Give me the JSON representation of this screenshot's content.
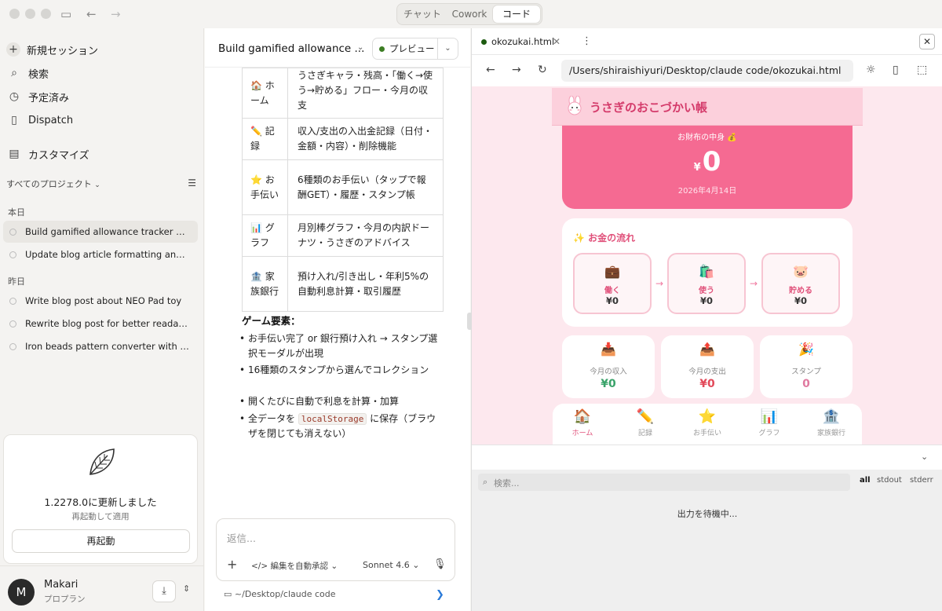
{
  "modes": {
    "items": [
      "チャット",
      "Cowork",
      "コード"
    ],
    "active": 2
  },
  "sidebar": {
    "nav": [
      {
        "label": "新規セッション",
        "icon": "plus-icon"
      },
      {
        "label": "検索",
        "icon": "search-icon"
      },
      {
        "label": "予定済み",
        "icon": "clock-icon"
      },
      {
        "label": "Dispatch",
        "icon": "phone-icon"
      },
      {
        "label": "カスタマイズ",
        "icon": "briefcase-icon"
      }
    ],
    "projects_label": "すべてのプロジェクト",
    "today_label": "本日",
    "yesterday_label": "昨日",
    "today_sessions": [
      "Build gamified allowance tracker app f...",
      "Update blog article formatting and rela..."
    ],
    "yesterday_sessions": [
      "Write blog post about NEO Pad toy",
      "Rewrite blog post for better readability",
      "Iron beads pattern converter with PDF ..."
    ],
    "update": {
      "title": "1.2278.0に更新しました",
      "subtitle": "再起動して適用",
      "button": "再起動"
    },
    "user": {
      "initial": "M",
      "name": "Makari",
      "plan": "プロプラン"
    }
  },
  "chat": {
    "title": "Build gamified allowance ...",
    "preview_label": "プレビュー",
    "table": [
      {
        "key": "🏠 ホーム",
        "value": "うさぎキャラ・残高・「働く→使う→貯める」フロー・今月の収支"
      },
      {
        "key": "✏️ 記録",
        "value": "収入/支出の入出金記録（日付・金額・内容）・削除機能"
      },
      {
        "key": "⭐ お手伝い",
        "value": "6種類のお手伝い（タップで報酬GET）・履歴・スタンプ帳"
      },
      {
        "key": "📊 グラフ",
        "value": "月別棒グラフ・今月の内訳ドーナツ・うさぎのアドバイス"
      },
      {
        "key": "🏦 家族銀行",
        "value": "預け入れ/引き出し・年利5%の自動利息計算・取引履歴"
      }
    ],
    "game_heading": "ゲーム要素：",
    "bullets": [
      "お手伝い完了 or 銀行預け入れ → スタンプ選択モーダルが出現",
      "16種類のスタンプから選んでコレクション",
      "開くたびに自動で利息を計算・加算"
    ],
    "bullet4_pre": "全データを",
    "bullet4_code": "localStorage",
    "bullet4_post": "に保存（ブラウザを閉じても消えない）",
    "composer": {
      "placeholder": "返信...",
      "mode": "</> 編集を自動承認",
      "model": "Sonnet 4.6"
    },
    "footer_path": "~/Desktop/claude code"
  },
  "preview": {
    "tab_title": "okozukai.html",
    "url": "/Users/shiraishiyuri/Desktop/claude code/okozukai.html",
    "app_title": "うさぎのおこづかい帳",
    "wallet_label": "お財布の中身 💰",
    "currency": "¥",
    "balance": "0",
    "date": "2026年4月14日",
    "flow_title": "✨ お金の流れ",
    "flow": [
      {
        "emoji": "💼",
        "label": "働く",
        "amount": "¥0"
      },
      {
        "emoji": "🛍️",
        "label": "使う",
        "amount": "¥0"
      },
      {
        "emoji": "🐷",
        "label": "貯める",
        "amount": "¥0"
      }
    ],
    "stats": [
      {
        "emoji": "📥",
        "label": "今月の収入",
        "value": "¥0",
        "color": "#3aa36a"
      },
      {
        "emoji": "📤",
        "label": "今月の支出",
        "value": "¥0",
        "color": "#e24a5a"
      },
      {
        "emoji": "🎉",
        "label": "スタンプ",
        "value": "0",
        "color": "#e07aa0"
      }
    ],
    "nav": [
      {
        "emoji": "🏠",
        "label": "ホーム"
      },
      {
        "emoji": "✏️",
        "label": "記録"
      },
      {
        "emoji": "⭐",
        "label": "お手伝い"
      },
      {
        "emoji": "📊",
        "label": "グラフ"
      },
      {
        "emoji": "🏦",
        "label": "家族銀行"
      }
    ],
    "console": {
      "placeholder": "検索...",
      "filters": [
        "all",
        "stdout",
        "stderr"
      ],
      "waiting": "出力を待機中..."
    }
  }
}
